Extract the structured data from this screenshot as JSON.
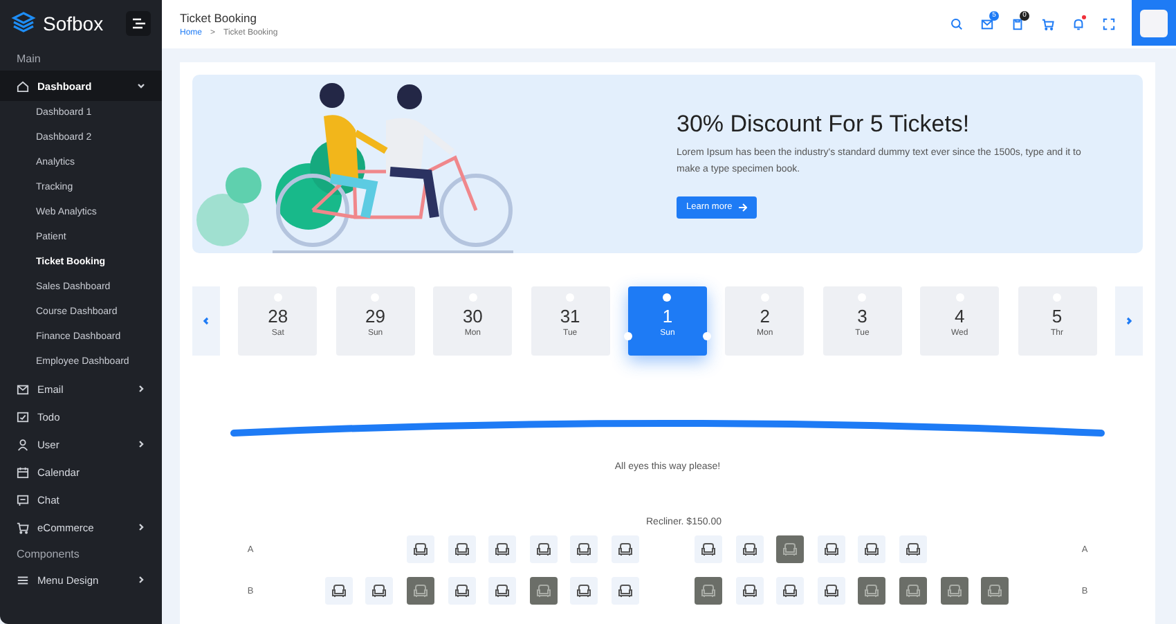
{
  "sidebar": {
    "logo": "Sofbox",
    "items": [
      {
        "kind": "heading",
        "label": "Main"
      },
      {
        "kind": "group",
        "label": "Dashboard",
        "expanded": true,
        "children": [
          {
            "label": "Dashboard 1",
            "selected": false
          },
          {
            "label": "Dashboard 2",
            "selected": false
          },
          {
            "label": "Analytics",
            "selected": false
          },
          {
            "label": "Tracking",
            "selected": false
          },
          {
            "label": "Web Analytics",
            "selected": false
          },
          {
            "label": "Patient",
            "selected": false
          },
          {
            "label": "Ticket Booking",
            "selected": true
          },
          {
            "label": "Sales Dashboard",
            "selected": false
          },
          {
            "label": "Course Dashboard",
            "selected": false
          },
          {
            "label": "Finance Dashboard",
            "selected": false
          },
          {
            "label": "Employee Dashboard",
            "selected": false
          }
        ]
      },
      {
        "kind": "group",
        "label": "Email",
        "expanded": false
      },
      {
        "kind": "link",
        "label": "Todo"
      },
      {
        "kind": "group",
        "label": "User",
        "expanded": false
      },
      {
        "kind": "link",
        "label": "Calendar"
      },
      {
        "kind": "link",
        "label": "Chat"
      },
      {
        "kind": "group",
        "label": "eCommerce",
        "expanded": false
      },
      {
        "kind": "heading",
        "label": "Components"
      },
      {
        "kind": "group",
        "label": "Menu Design",
        "expanded": false
      }
    ]
  },
  "header": {
    "title": "Ticket Booking",
    "breadcrumb": [
      "Home",
      "Ticket Booking"
    ],
    "breadcrumb_separator": ">",
    "mail_badge": "5",
    "tasks_badge": "0",
    "notification_dot": true
  },
  "banner": {
    "title": "30% Discount For 5 Tickets!",
    "text": "Lorem Ipsum has been the industry's standard dummy text ever since the 1500s, type and it to make a type specimen book.",
    "button": "Learn more"
  },
  "dates": [
    {
      "day": "28",
      "weekday": "Sat",
      "selected": false
    },
    {
      "day": "29",
      "weekday": "Sun",
      "selected": false
    },
    {
      "day": "30",
      "weekday": "Mon",
      "selected": false
    },
    {
      "day": "31",
      "weekday": "Tue",
      "selected": false
    },
    {
      "day": "1",
      "weekday": "Sun",
      "selected": true
    },
    {
      "day": "2",
      "weekday": "Mon",
      "selected": false
    },
    {
      "day": "3",
      "weekday": "Tue",
      "selected": false
    },
    {
      "day": "4",
      "weekday": "Wed",
      "selected": false
    },
    {
      "day": "5",
      "weekday": "Thr",
      "selected": false
    }
  ],
  "screen_caption": "All eyes this way please!",
  "seat_class": "Recliner. $150.00",
  "rows": [
    {
      "label_left": "A",
      "label_right": "A",
      "left": [
        {
          "booked": false
        },
        {
          "booked": false
        },
        {
          "booked": false
        },
        {
          "booked": false
        },
        {
          "booked": false
        },
        {
          "booked": false
        }
      ],
      "right": [
        {
          "booked": false
        },
        {
          "booked": false
        },
        {
          "booked": true
        },
        {
          "booked": false
        },
        {
          "booked": false
        },
        {
          "booked": false
        }
      ]
    },
    {
      "label_left": "B",
      "label_right": "B",
      "left": [
        {
          "booked": false
        },
        {
          "booked": false
        },
        {
          "booked": true
        },
        {
          "booked": false
        },
        {
          "booked": false
        },
        {
          "booked": true
        },
        {
          "booked": false
        },
        {
          "booked": false
        }
      ],
      "right": [
        {
          "booked": true
        },
        {
          "booked": false
        },
        {
          "booked": false
        },
        {
          "booked": false
        },
        {
          "booked": true
        },
        {
          "booked": true
        },
        {
          "booked": true
        },
        {
          "booked": true
        }
      ]
    }
  ]
}
